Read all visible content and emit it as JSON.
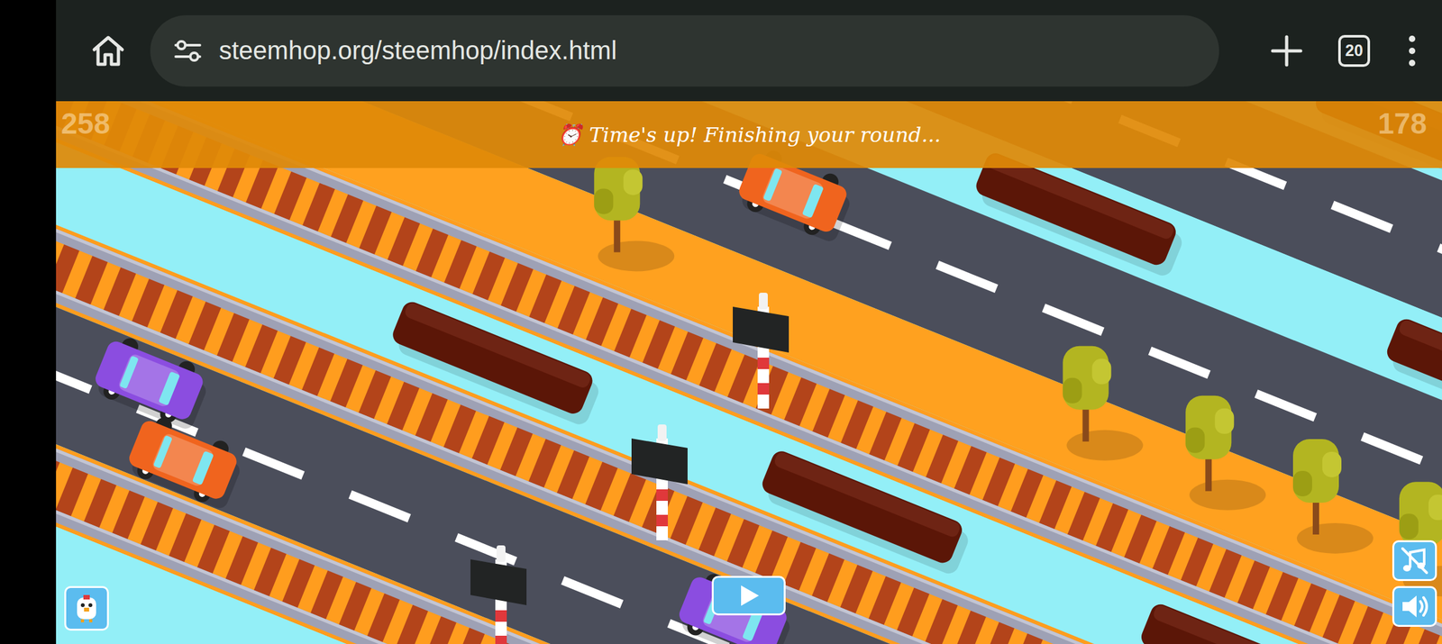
{
  "browser": {
    "url": "steemhop.org/steemhop/index.html",
    "tab_count": "20"
  },
  "game": {
    "banner": "⏰ Time's up! Finishing your round...",
    "score_left": "258",
    "score_right": "178",
    "lanes": [
      {
        "kind": "water"
      },
      {
        "kind": "road"
      },
      {
        "kind": "water"
      },
      {
        "kind": "road"
      },
      {
        "kind": "grass"
      },
      {
        "kind": "rail"
      },
      {
        "kind": "water"
      },
      {
        "kind": "rail"
      },
      {
        "kind": "road"
      },
      {
        "kind": "rail"
      },
      {
        "kind": "water"
      }
    ],
    "cars": [
      {
        "color": "#f0641e"
      },
      {
        "color": "#8b4de0"
      },
      {
        "color": "#f0641e"
      },
      {
        "color": "#8b4de0"
      }
    ],
    "music_on": false,
    "sound_on": true
  }
}
